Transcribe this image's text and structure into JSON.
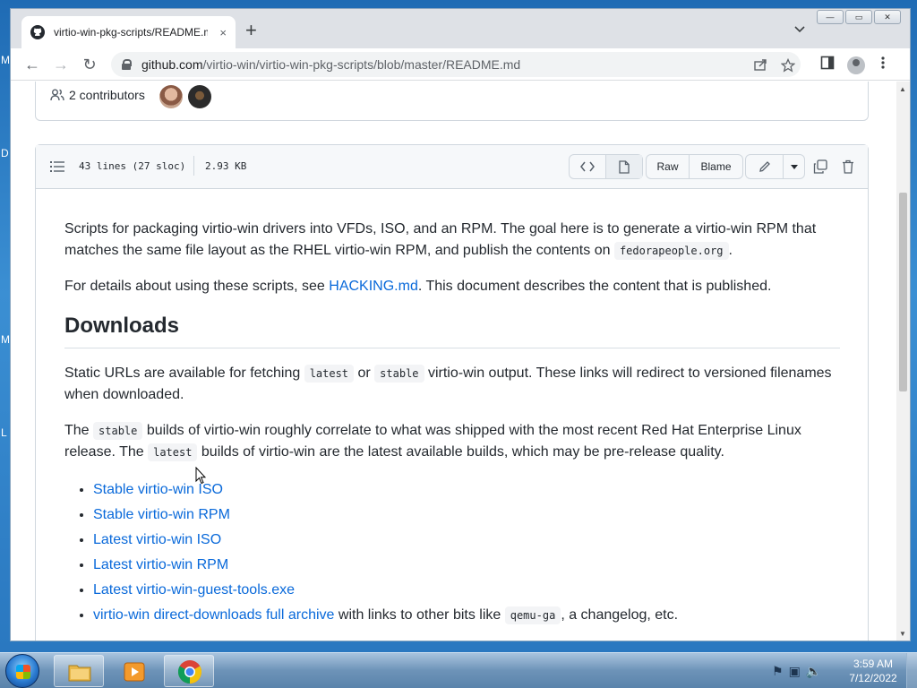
{
  "desktop": {
    "side_letters": [
      "M",
      "D",
      "M",
      "L"
    ]
  },
  "browser": {
    "tab": {
      "title": "virtio-win-pkg-scripts/README.md",
      "close": "×"
    },
    "new_tab": "+",
    "tab_search": "⌄",
    "window_buttons": {
      "minimize": "—",
      "maximize": "▭",
      "close": "✕"
    },
    "nav": {
      "back": "←",
      "forward": "→",
      "reload": "↻"
    },
    "url_domain": "github.com",
    "url_path": "/virtio-win/virtio-win-pkg-scripts/blob/master/README.md",
    "icons": {
      "share": "share-icon",
      "star": "star-icon",
      "sidepanel": "side-panel-icon",
      "profile": "profile-icon",
      "menu": "kebab-menu-icon"
    }
  },
  "contributors": {
    "label": "2 contributors"
  },
  "file_header": {
    "lines": "43 lines (27 sloc)",
    "size": "2.93 KB",
    "raw": "Raw",
    "blame": "Blame"
  },
  "readme": {
    "p1_a": "Scripts for packaging virtio-win drivers into VFDs, ISO, and an RPM. The goal here is to generate a virtio-win RPM that matches the same file layout as the RHEL virtio-win RPM, and publish the contents on ",
    "p1_code": "fedorapeople.org",
    "p1_b": ".",
    "p2_a": "For details about using these scripts, see ",
    "p2_link": "HACKING.md",
    "p2_b": ". This document describes the content that is published.",
    "h_downloads": "Downloads",
    "p3_a": "Static URLs are available for fetching ",
    "p3_code1": "latest",
    "p3_mid": " or ",
    "p3_code2": "stable",
    "p3_b": " virtio-win output. These links will redirect to versioned filenames when downloaded.",
    "p4_a": "The ",
    "p4_code1": "stable",
    "p4_b": " builds of virtio-win roughly correlate to what was shipped with the most recent Red Hat Enterprise Linux release. The ",
    "p4_code2": "latest",
    "p4_c": " builds of virtio-win are the latest available builds, which may be pre-release quality.",
    "links": [
      "Stable virtio-win ISO",
      "Stable virtio-win RPM",
      "Latest virtio-win ISO",
      "Latest virtio-win RPM",
      "Latest virtio-win-guest-tools.exe"
    ],
    "last_item_link": "virtio-win direct-downloads full archive",
    "last_item_a": " with links to other bits like ",
    "last_item_code": "qemu-ga",
    "last_item_b": ", a changelog, etc."
  },
  "taskbar": {
    "time": "3:59 AM",
    "date": "7/12/2022"
  },
  "colors": {
    "link": "#0969da",
    "text": "#24292f",
    "border": "#d0d7de"
  }
}
